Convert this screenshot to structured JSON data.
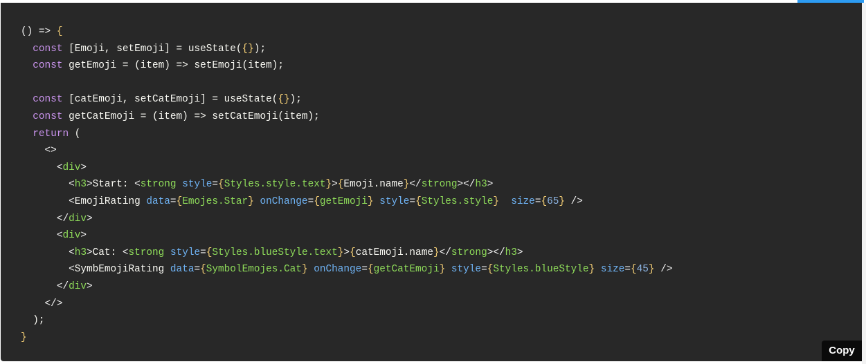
{
  "code_block": {
    "language": "jsx",
    "lines": [
      [
        {
          "t": "() ",
          "c": "punct"
        },
        {
          "t": "=>",
          "c": "punct"
        },
        {
          "t": " ",
          "c": "text"
        },
        {
          "t": "{",
          "c": "brace"
        }
      ],
      [
        {
          "t": "  ",
          "c": "text"
        },
        {
          "t": "const",
          "c": "kw"
        },
        {
          "t": " [Emoji, setEmoji] = useState(",
          "c": "text"
        },
        {
          "t": "{}",
          "c": "brace"
        },
        {
          "t": ");",
          "c": "text"
        }
      ],
      [
        {
          "t": "  ",
          "c": "text"
        },
        {
          "t": "const",
          "c": "kw"
        },
        {
          "t": " getEmoji = (item) => setEmoji(item);",
          "c": "text"
        }
      ],
      [
        {
          "t": "",
          "c": "text"
        }
      ],
      [
        {
          "t": "  ",
          "c": "text"
        },
        {
          "t": "const",
          "c": "kw"
        },
        {
          "t": " [catEmoji, setCatEmoji] = useState(",
          "c": "text"
        },
        {
          "t": "{}",
          "c": "brace"
        },
        {
          "t": ");",
          "c": "text"
        }
      ],
      [
        {
          "t": "  ",
          "c": "text"
        },
        {
          "t": "const",
          "c": "kw"
        },
        {
          "t": " getCatEmoji = (item) => setCatEmoji(item);",
          "c": "text"
        }
      ],
      [
        {
          "t": "  ",
          "c": "text"
        },
        {
          "t": "return",
          "c": "kw"
        },
        {
          "t": " (",
          "c": "text"
        }
      ],
      [
        {
          "t": "    ",
          "c": "text"
        },
        {
          "t": "<>",
          "c": "punct"
        }
      ],
      [
        {
          "t": "      ",
          "c": "text"
        },
        {
          "t": "<",
          "c": "punct"
        },
        {
          "t": "div",
          "c": "tag"
        },
        {
          "t": ">",
          "c": "punct"
        }
      ],
      [
        {
          "t": "        ",
          "c": "text"
        },
        {
          "t": "<",
          "c": "punct"
        },
        {
          "t": "h3",
          "c": "tag"
        },
        {
          "t": ">",
          "c": "punct"
        },
        {
          "t": "Start: ",
          "c": "text"
        },
        {
          "t": "<",
          "c": "punct"
        },
        {
          "t": "strong",
          "c": "tag"
        },
        {
          "t": " ",
          "c": "text"
        },
        {
          "t": "style",
          "c": "attr"
        },
        {
          "t": "=",
          "c": "punct"
        },
        {
          "t": "{",
          "c": "brace"
        },
        {
          "t": "Styles.style.text",
          "c": "val"
        },
        {
          "t": "}",
          "c": "brace"
        },
        {
          "t": ">",
          "c": "punct"
        },
        {
          "t": "{",
          "c": "brace"
        },
        {
          "t": "Emoji.name",
          "c": "text"
        },
        {
          "t": "}",
          "c": "brace"
        },
        {
          "t": "</",
          "c": "punct"
        },
        {
          "t": "strong",
          "c": "tag"
        },
        {
          "t": "></",
          "c": "punct"
        },
        {
          "t": "h3",
          "c": "tag"
        },
        {
          "t": ">",
          "c": "punct"
        }
      ],
      [
        {
          "t": "        ",
          "c": "text"
        },
        {
          "t": "<",
          "c": "punct"
        },
        {
          "t": "EmojiRating",
          "c": "text"
        },
        {
          "t": " ",
          "c": "text"
        },
        {
          "t": "data",
          "c": "attr"
        },
        {
          "t": "=",
          "c": "punct"
        },
        {
          "t": "{",
          "c": "brace"
        },
        {
          "t": "Emojes.Star",
          "c": "val"
        },
        {
          "t": "}",
          "c": "brace"
        },
        {
          "t": " ",
          "c": "text"
        },
        {
          "t": "onChange",
          "c": "attr"
        },
        {
          "t": "=",
          "c": "punct"
        },
        {
          "t": "{",
          "c": "brace"
        },
        {
          "t": "getEmoji",
          "c": "val"
        },
        {
          "t": "}",
          "c": "brace"
        },
        {
          "t": " ",
          "c": "text"
        },
        {
          "t": "style",
          "c": "attr"
        },
        {
          "t": "=",
          "c": "punct"
        },
        {
          "t": "{",
          "c": "brace"
        },
        {
          "t": "Styles.style",
          "c": "val"
        },
        {
          "t": "}",
          "c": "brace"
        },
        {
          "t": "  ",
          "c": "text"
        },
        {
          "t": "size",
          "c": "attr"
        },
        {
          "t": "=",
          "c": "punct"
        },
        {
          "t": "{",
          "c": "brace"
        },
        {
          "t": "65",
          "c": "num"
        },
        {
          "t": "}",
          "c": "brace"
        },
        {
          "t": " />",
          "c": "punct"
        }
      ],
      [
        {
          "t": "      ",
          "c": "text"
        },
        {
          "t": "</",
          "c": "punct"
        },
        {
          "t": "div",
          "c": "tag"
        },
        {
          "t": ">",
          "c": "punct"
        }
      ],
      [
        {
          "t": "      ",
          "c": "text"
        },
        {
          "t": "<",
          "c": "punct"
        },
        {
          "t": "div",
          "c": "tag"
        },
        {
          "t": ">",
          "c": "punct"
        }
      ],
      [
        {
          "t": "        ",
          "c": "text"
        },
        {
          "t": "<",
          "c": "punct"
        },
        {
          "t": "h3",
          "c": "tag"
        },
        {
          "t": ">",
          "c": "punct"
        },
        {
          "t": "Cat: ",
          "c": "text"
        },
        {
          "t": "<",
          "c": "punct"
        },
        {
          "t": "strong",
          "c": "tag"
        },
        {
          "t": " ",
          "c": "text"
        },
        {
          "t": "style",
          "c": "attr"
        },
        {
          "t": "=",
          "c": "punct"
        },
        {
          "t": "{",
          "c": "brace"
        },
        {
          "t": "Styles.blueStyle.text",
          "c": "val"
        },
        {
          "t": "}",
          "c": "brace"
        },
        {
          "t": ">",
          "c": "punct"
        },
        {
          "t": "{",
          "c": "brace"
        },
        {
          "t": "catEmoji.name",
          "c": "text"
        },
        {
          "t": "}",
          "c": "brace"
        },
        {
          "t": "</",
          "c": "punct"
        },
        {
          "t": "strong",
          "c": "tag"
        },
        {
          "t": "></",
          "c": "punct"
        },
        {
          "t": "h3",
          "c": "tag"
        },
        {
          "t": ">",
          "c": "punct"
        }
      ],
      [
        {
          "t": "        ",
          "c": "text"
        },
        {
          "t": "<",
          "c": "punct"
        },
        {
          "t": "SymbEmojiRating",
          "c": "text"
        },
        {
          "t": " ",
          "c": "text"
        },
        {
          "t": "data",
          "c": "attr"
        },
        {
          "t": "=",
          "c": "punct"
        },
        {
          "t": "{",
          "c": "brace"
        },
        {
          "t": "SymbolEmojes.Cat",
          "c": "val"
        },
        {
          "t": "}",
          "c": "brace"
        },
        {
          "t": " ",
          "c": "text"
        },
        {
          "t": "onChange",
          "c": "attr"
        },
        {
          "t": "=",
          "c": "punct"
        },
        {
          "t": "{",
          "c": "brace"
        },
        {
          "t": "getCatEmoji",
          "c": "val"
        },
        {
          "t": "}",
          "c": "brace"
        },
        {
          "t": " ",
          "c": "text"
        },
        {
          "t": "style",
          "c": "attr"
        },
        {
          "t": "=",
          "c": "punct"
        },
        {
          "t": "{",
          "c": "brace"
        },
        {
          "t": "Styles.blueStyle",
          "c": "val"
        },
        {
          "t": "}",
          "c": "brace"
        },
        {
          "t": " ",
          "c": "text"
        },
        {
          "t": "size",
          "c": "attr"
        },
        {
          "t": "=",
          "c": "punct"
        },
        {
          "t": "{",
          "c": "brace"
        },
        {
          "t": "45",
          "c": "num"
        },
        {
          "t": "}",
          "c": "brace"
        },
        {
          "t": " />",
          "c": "punct"
        }
      ],
      [
        {
          "t": "      ",
          "c": "text"
        },
        {
          "t": "</",
          "c": "punct"
        },
        {
          "t": "div",
          "c": "tag"
        },
        {
          "t": ">",
          "c": "punct"
        }
      ],
      [
        {
          "t": "    ",
          "c": "text"
        },
        {
          "t": "</>",
          "c": "punct"
        }
      ],
      [
        {
          "t": "  );",
          "c": "text"
        }
      ],
      [
        {
          "t": "}",
          "c": "brace"
        }
      ]
    ]
  },
  "copy_button": {
    "label": "Copy"
  },
  "colors": {
    "background": "#282828",
    "accent": "#2d9cf3",
    "keyword": "#c792ea",
    "tag": "#8fdc5a",
    "attribute": "#6fb3f4",
    "brace": "#f2cd75",
    "number": "#8fb7e6",
    "copy_button_bg": "#0a0a0a"
  }
}
